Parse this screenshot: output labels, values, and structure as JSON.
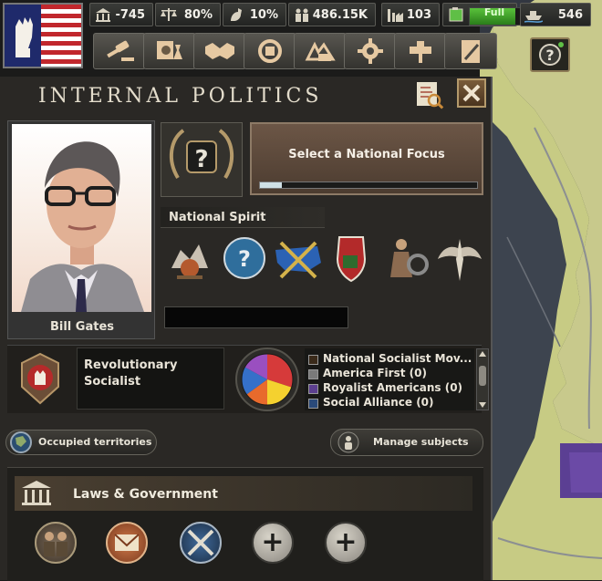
{
  "topbar": {
    "political_power": "-745",
    "stability": "80%",
    "war_support": "10%",
    "manpower": "486.15K",
    "factories": "103",
    "fuel": {
      "label": "Full",
      "fill_fraction": 0.9
    },
    "convoys": "546"
  },
  "toolbar": {
    "buttons": [
      "politics-gavel-icon",
      "research-flask-icon",
      "diplomacy-handshake-icon",
      "trade-icon",
      "construction-icon",
      "production-gear-icon",
      "army-helmet-icon",
      "logistics-clipboard-icon"
    ]
  },
  "panel": {
    "title": "Internal Politics",
    "leader_name": "Bill Gates",
    "focus": {
      "label": "Select a National Focus",
      "progress_fraction": 0.1
    },
    "national_spirit_label": "National Spirit",
    "ideology": {
      "name": "Revolutionary Socialist"
    },
    "parties": [
      {
        "label": "National Socialist Mov...",
        "color": "#3a2a1a"
      },
      {
        "label": "America First (0)",
        "color": "#7a7a7a"
      },
      {
        "label": "Royalist Americans (0)",
        "color": "#5c3f8f"
      },
      {
        "label": "Social Alliance (0)",
        "color": "#2a4a7a"
      }
    ],
    "pie": [
      {
        "share": 0.3,
        "color": "#d63a3a"
      },
      {
        "share": 0.2,
        "color": "#f4d12f"
      },
      {
        "share": 0.15,
        "color": "#e86a2c"
      },
      {
        "share": 0.18,
        "color": "#3570c9"
      },
      {
        "share": 0.17,
        "color": "#9a4fc0"
      }
    ],
    "occupied_label": "Occupied territories",
    "subjects_label": "Manage subjects",
    "laws_label": "Laws & Government"
  }
}
